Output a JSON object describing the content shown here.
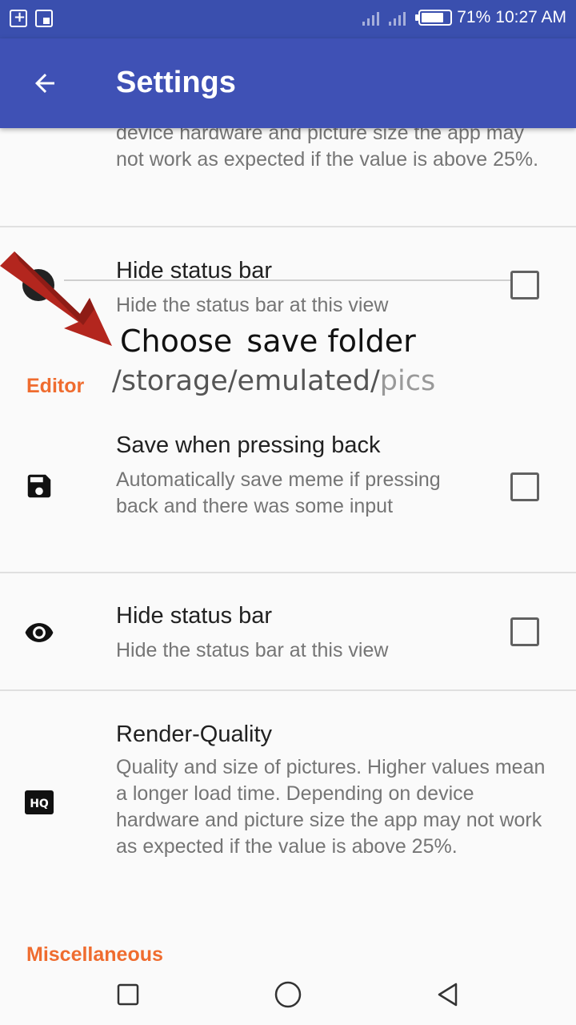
{
  "status_bar": {
    "battery": "71%",
    "time": "10:27 AM"
  },
  "toolbar": {
    "title": "Settings",
    "back_icon": "arrow-back-icon"
  },
  "top_partial_summary": "device hardware and picture size the app may not work as expected if the value is above 25%.",
  "overlay": {
    "faded_pref_title": "Hide status bar",
    "faded_pref_summary": "Hide the status bar at this view",
    "choose_label_part1": "Choose",
    "choose_label_part2": "save folder",
    "path_dark": "/storage/emulated/",
    "path_light": "pics",
    "arrow_color": "#b71c1c"
  },
  "categories": {
    "editor": "Editor",
    "misc": "Miscellaneous"
  },
  "prefs": [
    {
      "title": "Save when pressing back",
      "summary": "Automatically save meme if pressing back and there was some input",
      "icon": "save-icon",
      "checked": false
    },
    {
      "title": "Hide status bar",
      "summary": "Hide the status bar at this view",
      "icon": "eye-icon",
      "checked": false
    },
    {
      "title": "Render-Quality",
      "summary": "Quality and size of pictures. Higher values mean a longer load time. Depending on device hardware and picture size the app may not work as expected if the value is above 25%.",
      "icon": "hq-icon"
    }
  ],
  "colors": {
    "primary": "#3f51b5",
    "status_bar": "#3a4fae",
    "accent": "#ef6c2f"
  }
}
